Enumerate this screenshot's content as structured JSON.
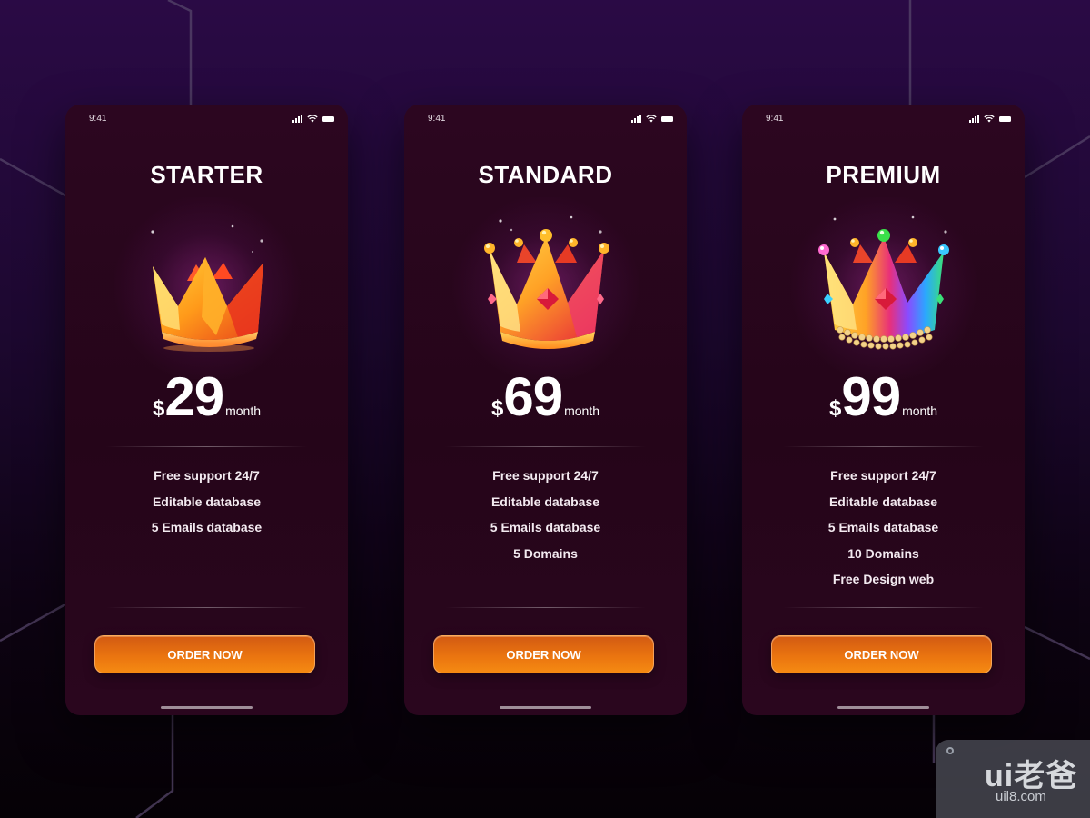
{
  "colors": {
    "background_top": "#2a0a45",
    "background_bottom": "#050105",
    "card_background": "#2a061e",
    "button_orange": "#ea7410",
    "text_white": "#ffffff"
  },
  "plans": [
    {
      "status_time": "9:41",
      "name": "STARTER",
      "crown_icon": "gold-crown-icon",
      "currency": "$",
      "amount": "29",
      "period": "month",
      "features": [
        "Free support 24/7",
        "Editable database",
        "5 Emails database"
      ],
      "cta": "ORDER NOW"
    },
    {
      "status_time": "9:41",
      "name": "STANDARD",
      "crown_icon": "jeweled-crown-icon",
      "currency": "$",
      "amount": "69",
      "period": "month",
      "features": [
        "Free support 24/7",
        "Editable database",
        "5 Emails database",
        "5 Domains"
      ],
      "cta": "ORDER NOW"
    },
    {
      "status_time": "9:41",
      "name": "PREMIUM",
      "crown_icon": "rainbow-pearl-crown-icon",
      "currency": "$",
      "amount": "99",
      "period": "month",
      "features": [
        "Free support 24/7",
        "Editable database",
        "5 Emails database",
        "10 Domains",
        "Free Design web"
      ],
      "cta": "ORDER NOW"
    }
  ],
  "watermark": {
    "logo_text": "ui老爸",
    "url": "uil8.com"
  }
}
